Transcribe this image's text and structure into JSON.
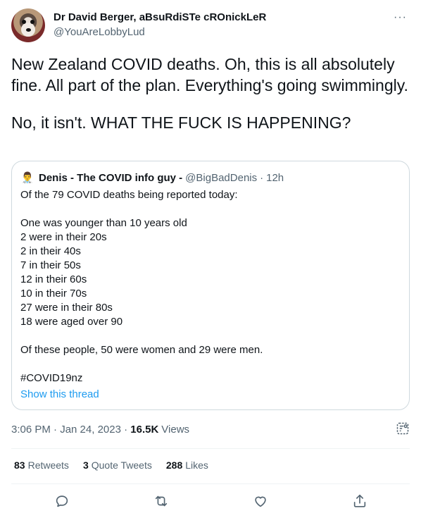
{
  "author": {
    "display_name": "Dr David Berger, aBsuRdiSTe cROnickLeR",
    "handle": "@YouAreLobbyLud"
  },
  "tweet": {
    "paragraphs": [
      "New Zealand COVID deaths. Oh, this is all absolutely fine. All part of the plan. Everything's going swimmingly.",
      "No, it isn't. WHAT THE FUCK IS HAPPENING?"
    ]
  },
  "quote": {
    "avatar_glyph": "👨‍⚕",
    "name": "Denis - The COVID info guy -",
    "handle": "@BigBadDenis",
    "separator": "·",
    "time": "12h",
    "lines": [
      "Of the 79 COVID deaths being reported today:",
      "",
      "One was younger than 10 years old",
      "2 were in their 20s",
      "2 in their 40s",
      "7 in their 50s",
      "12 in their 60s",
      "10 in their 70s",
      "27 were in their 80s",
      "18 were aged over 90",
      "",
      "Of these people, 50 were women and 29 were men.",
      "",
      "#COVID19nz"
    ],
    "show_thread": "Show this thread"
  },
  "meta": {
    "timestamp": "3:06 PM · Jan 24, 2023 · ",
    "views_count": "16.5K",
    "views_label": "Views"
  },
  "stats": {
    "retweets_count": "83",
    "retweets_label": "Retweets",
    "quotes_count": "3",
    "quotes_label": "Quote Tweets",
    "likes_count": "288",
    "likes_label": "Likes"
  },
  "more_glyph": "···",
  "colors": {
    "text": "#0f1419",
    "secondary": "#536471",
    "link": "#1d9bf0",
    "border": "#cfd9de"
  },
  "icons": [
    "reply-icon",
    "retweet-icon",
    "like-icon",
    "share-icon",
    "analytics-icon",
    "more-icon"
  ]
}
